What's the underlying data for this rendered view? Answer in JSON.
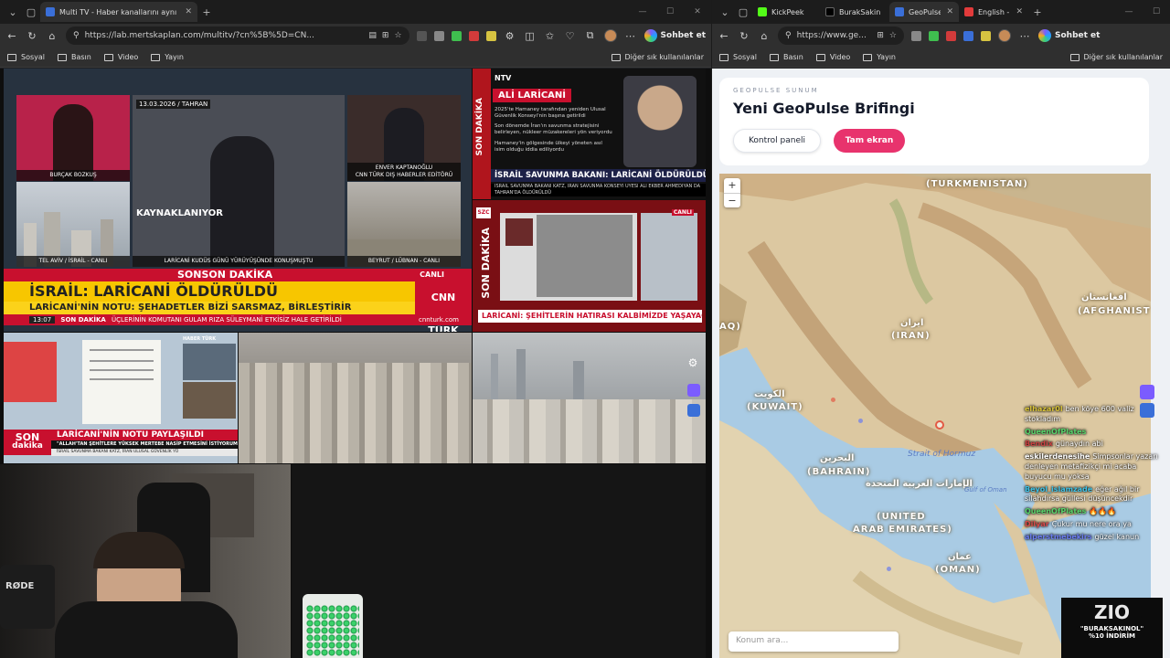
{
  "left_window": {
    "tabs": [
      {
        "label": "Multi TV - Haber kanallarını aynı a",
        "active": true,
        "favicon_color": "#3a6fd8"
      }
    ],
    "new_tab": "+",
    "url": "https://lab.mertskaplan.com/multitv/?cn%5B%5D=CN...",
    "chat_label": "Sohbet et",
    "bookmarks": [
      "Sosyal",
      "Basın",
      "Video",
      "Yayın"
    ],
    "other_bookmarks": "Diğer sık kullanılanlar"
  },
  "right_window": {
    "tabs": [
      {
        "label": "KickPeek",
        "active": false,
        "favicon_color": "#53fc18"
      },
      {
        "label": "BurakSakin",
        "active": false,
        "favicon_color": "#000000"
      },
      {
        "label": "GeoPulse",
        "active": true,
        "favicon_color": "#3a6fd8"
      },
      {
        "label": "English - T",
        "active": false,
        "favicon_color": "#e23b3b"
      }
    ],
    "new_tab": "+",
    "url": "https://www.ge...",
    "chat_label": "Sohbet et",
    "bookmarks": [
      "Sosyal",
      "Basın",
      "Video",
      "Yayın"
    ],
    "other_bookmarks": "Diğer sık kullanılanlar"
  },
  "cnn_panel": {
    "caption_tahran": "13.03.2026 / TAHRAN",
    "kaynak": "KAYNAKLANIYOR",
    "name_left": "BURÇAK BOZKUŞ",
    "name_right1": "ENVER KAPTANOĞLU",
    "name_right2": "CNN TÜRK DIŞ HABERLER EDİTÖRÜ",
    "loc_telaviv": "TEL AVİV / İSRAİL - CANLI",
    "loc_beyrut": "BEYRUT / LÜBNAN - CANLI",
    "center_caption": "LARİCANİ KUDÜS GÜNÜ YÜRÜYÜŞÜNDE KONUŞMUŞTU",
    "sonson": "SONSON DAKİKA",
    "canli": "CANLI",
    "headline": "İSRAİL: LARİCANİ ÖLDÜRÜLDÜ",
    "subheadline": "LARİCANİ'NİN NOTU: ŞEHADETLER BİZİ SARSMAZ, BİRLEŞTİRİR",
    "time": "13:07",
    "son_dakika": "SON DAKİKA",
    "ticker": "ÜÇLERİNİN KOMUTANI GULAM RIZA SÜLEYMANİ ETKİSİZ HALE GETİRİLDİ",
    "website": "cnnturk.com",
    "logo": "CNN TÜRK"
  },
  "ntv_panel": {
    "logo": "NTV",
    "name": "ALİ LARİCANİ",
    "side": "SON DAKİKA",
    "bullet1": "2025'te Hamaney tarafından yeniden Ulusal Güvenlik Konseyi'nin başına getirildi",
    "bullet2": "Son dönemde İran'ın savunma stratejisini belirleyen, nükleer müzakereleri yön veriyordu",
    "bullet3": "Hamaney'in gölgesinde ülkeyi yöneten asıl isim olduğu iddia ediliyordu",
    "headline": "İSRAİL SAVUNMA BAKANI: LARİCANİ ÖLDÜRÜLDÜ",
    "ticker": "İSRAİL SAVUNMA BAKANI KATZ, İRAN SAVUNMA KONSEYİ ÜYESİ ALİ EKBER AHMEDİYAN DA TAHRAN'DA ÖLDÜRÜLDÜ"
  },
  "sozcu_panel": {
    "logo": "SZC",
    "side": "SON DAKİKA",
    "canli": "CANLI",
    "headline": "LARİCANİ: ŞEHİTLERİN HATIRASI KALBİMİZDE YAŞAYACAK"
  },
  "haber_panel": {
    "logo": "HABER TÜRK",
    "son": "SON",
    "dakika": "dakika",
    "headline": "LARİCANİ'NİN NOTU PAYLAŞILDI",
    "quote": "\"ALLAH'TAN ŞEHİTLERE YÜKSEK MERTEBE NASİP ETMESİNİ İSTİYORUM\"",
    "ticker": "İSRAİL SAVUNMA BAKANI KATZ, İRAN ULUSAL GÜVENLİK YÜ"
  },
  "camera": {
    "mic_brand": "RØDE"
  },
  "geopulse": {
    "subtitle": "GEOPULSE SUNUM",
    "title": "Yeni GeoPulse Brifingi",
    "btn_control": "Kontrol paneli",
    "btn_fullscreen": "Tam ekran",
    "search_placeholder": "Konum ara...",
    "zoom_in": "+",
    "zoom_out": "−"
  },
  "map_labels": {
    "turkmenistan": "(TURKMENISTAN)",
    "afghanistan": "(AFGHANIST",
    "afghanistan_native": "افغانستان",
    "iran_native": "ایران",
    "iran": "(IRAN)",
    "iraq": "AQ)",
    "kuwait_native": "الكويت",
    "kuwait": "(KUWAIT)",
    "bahrain_native": "البحرين",
    "bahrain": "(BAHRAIN)",
    "uae_native": "الإمارات العربية المتحدة",
    "uae1": "(UNITED",
    "uae2": "ARAB EMIRATES)",
    "oman_native": "عمان",
    "oman": "(OMAN)",
    "strait": "Strait of Hormuz",
    "gulf": "Gulf of Oman"
  },
  "chat": [
    {
      "user": "elhazar0l",
      "user_color": "#d9c43a",
      "text": "ben köye 600 valiz stokladım"
    },
    {
      "user": "QueenOfPlates",
      "user_color": "#58d36b",
      "text": ""
    },
    {
      "user": "Bendix",
      "user_color": "#c94040",
      "text": "günaydın abi"
    },
    {
      "user": "eskilerdenesihe",
      "user_color": "#ffffff",
      "text": "Simpsonlar yazarı denleyen metafizikçi mi acaba buyucu mu yoksa"
    },
    {
      "user": "Beyol_islamzade",
      "user_color": "#3dc2e6",
      "text": "eğer ağıl bir silahdırsa güllesi düşüncekdir"
    },
    {
      "user": "QueenOfPlates",
      "user_color": "#58d36b",
      "text": "🔥🔥🔥"
    },
    {
      "user": "Dilyar",
      "user_color": "#d94a4a",
      "text": "Çukur mu nere ora ya"
    },
    {
      "user": "alperstmebekirs",
      "user_color": "#6a7cf0",
      "text": "güzel kanun"
    }
  ],
  "promo": {
    "logo": "ZIO",
    "line1": "\"BURAKSAKINOL\"",
    "line2": "%10 İNDİRİM"
  }
}
